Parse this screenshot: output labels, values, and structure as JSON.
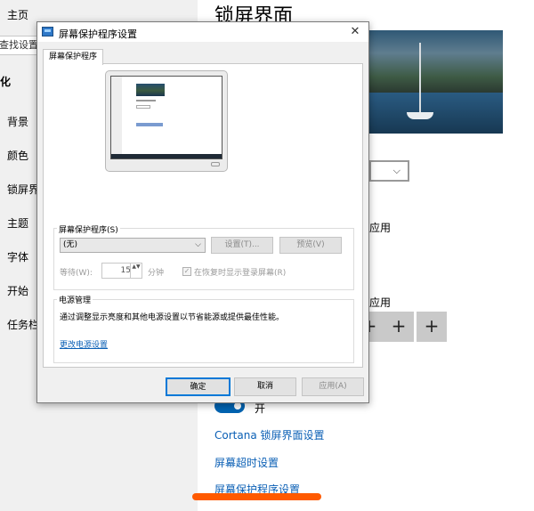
{
  "settings": {
    "nav": {
      "home": "主页",
      "search": "查找设置",
      "section": "化",
      "items": [
        "背景",
        "颜色",
        "锁屏界",
        "主题",
        "字体",
        "开始",
        "任务栏"
      ]
    },
    "page_title": "锁屏界面",
    "peek": [
      "应用",
      "应用"
    ],
    "plus_buttons": [
      "+",
      "+",
      "+"
    ],
    "toggle_label": "开",
    "links": {
      "cortana": "Cortana 锁屏界面设置",
      "timeout": "屏幕超时设置",
      "screensaver": "屏幕保护程序设置"
    }
  },
  "dialog": {
    "title": "屏幕保护程序设置",
    "close_glyph": "✕",
    "tab": "屏幕保护程序",
    "screensaver_group": {
      "label": "屏幕保护程序(S)",
      "selected": "(无)",
      "caret": "⌵",
      "settings_button": "设置(T)...",
      "preview_button": "预览(V)",
      "wait_label": "等待(W):",
      "wait_value": "15",
      "spin_glyph": "▲▼",
      "wait_unit": "分钟",
      "resume_label": "在恢复时显示登录屏幕(R)",
      "resume_checked": true,
      "check_glyph": "✓"
    },
    "power_group": {
      "label": "电源管理",
      "description": "通过调整显示亮度和其他电源设置以节省能源或提供最佳性能。",
      "link": "更改电源设置"
    },
    "buttons": {
      "ok": "确定",
      "cancel": "取消",
      "apply": "应用(A)"
    }
  },
  "colors": {
    "accent": "#0078d7",
    "link": "#0a5fb5",
    "highlight": "#ff5a00"
  }
}
